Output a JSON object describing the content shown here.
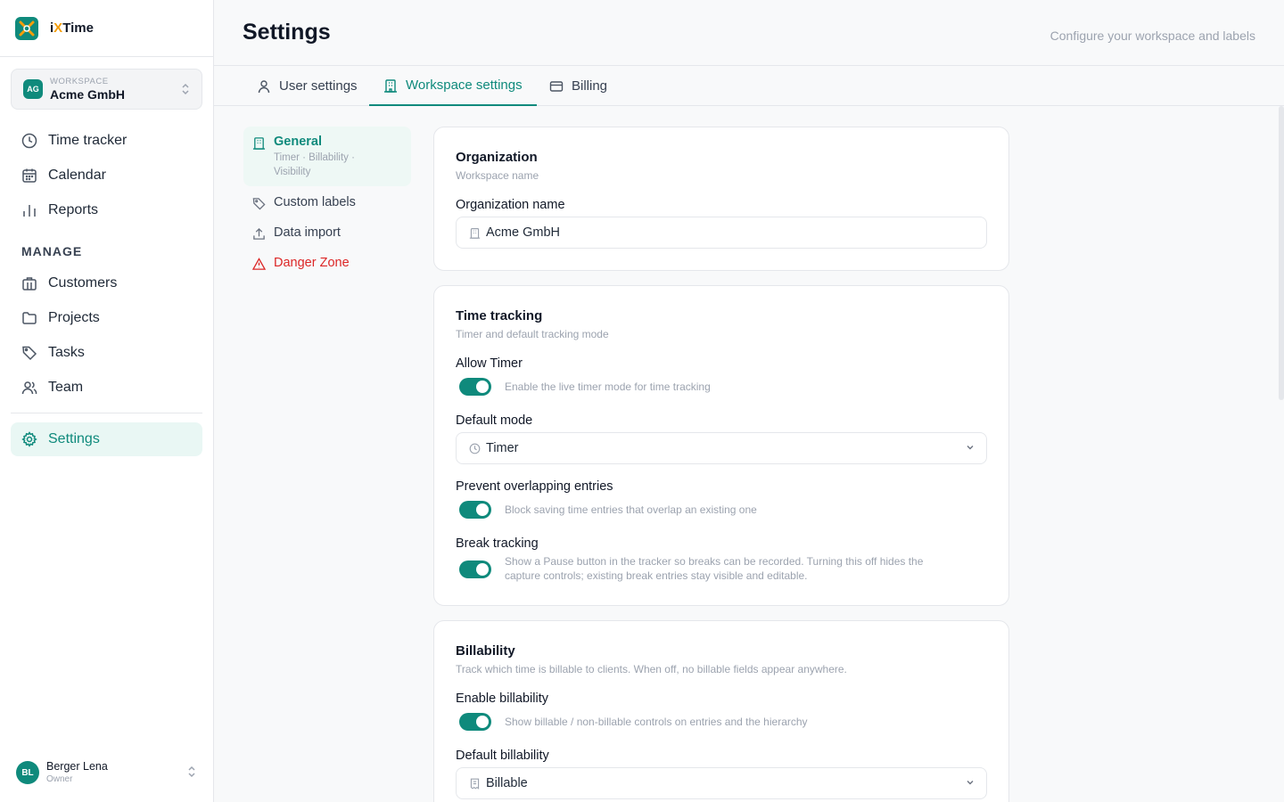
{
  "brand": {
    "prefix": "i",
    "x": "X",
    "suffix": "Time"
  },
  "workspace": {
    "initials": "AG",
    "label": "WORKSPACE",
    "name": "Acme GmbH"
  },
  "nav": {
    "time_tracker": "Time tracker",
    "calendar": "Calendar",
    "reports": "Reports",
    "manage_label": "MANAGE",
    "customers": "Customers",
    "projects": "Projects",
    "tasks": "Tasks",
    "team": "Team",
    "settings": "Settings"
  },
  "user": {
    "initials": "BL",
    "name": "Berger Lena",
    "role": "Owner"
  },
  "header": {
    "title": "Settings",
    "subtitle": "Configure your workspace and labels"
  },
  "tabs": [
    {
      "label": "User settings",
      "icon": "user-icon"
    },
    {
      "label": "Workspace settings",
      "icon": "building-icon",
      "active": true
    },
    {
      "label": "Billing",
      "icon": "credit-card-icon"
    }
  ],
  "subnav": {
    "general": {
      "label": "General",
      "detail": "Timer · Billability · Visibility"
    },
    "custom_labels": "Custom labels",
    "data_import": "Data import",
    "danger_zone": "Danger Zone"
  },
  "organization": {
    "title": "Organization",
    "subtitle": "Workspace name",
    "name_label": "Organization name",
    "name_value": "Acme GmbH"
  },
  "time_tracking": {
    "title": "Time tracking",
    "subtitle": "Timer and default tracking mode",
    "allow_timer_label": "Allow Timer",
    "allow_timer_on": true,
    "allow_timer_desc": "Enable the live timer mode for time tracking",
    "default_mode_label": "Default mode",
    "default_mode_value": "Timer",
    "prevent_overlap_label": "Prevent overlapping entries",
    "prevent_overlap_on": true,
    "prevent_overlap_desc": "Block saving time entries that overlap an existing one",
    "break_tracking_label": "Break tracking",
    "break_tracking_on": true,
    "break_tracking_desc": "Show a Pause button in the tracker so breaks can be recorded. Turning this off hides the capture controls; existing break entries stay visible and editable."
  },
  "billability": {
    "title": "Billability",
    "subtitle": "Track which time is billable to clients. When off, no billable fields appear anywhere.",
    "enable_label": "Enable billability",
    "enable_on": true,
    "enable_desc": "Show billable / non-billable controls on entries and the hierarchy",
    "default_label": "Default billability",
    "default_value": "Billable"
  },
  "colors": {
    "accent": "#0f8a7c",
    "danger": "#dc2626",
    "brand_x": "#f59e0b"
  }
}
